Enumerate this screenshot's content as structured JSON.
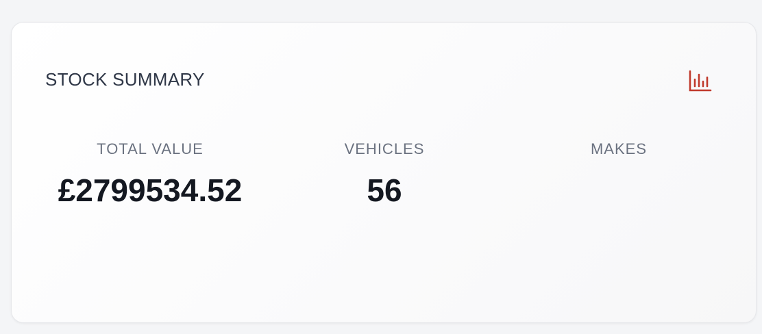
{
  "summary": {
    "title": "STOCK SUMMARY",
    "icon": "bar-chart-icon",
    "accent_color": "#c0392b",
    "stats": [
      {
        "label": "TOTAL VALUE",
        "value": "£2799534.52"
      },
      {
        "label": "VEHICLES",
        "value": "56"
      },
      {
        "label": "MAKES",
        "value": ""
      }
    ]
  }
}
